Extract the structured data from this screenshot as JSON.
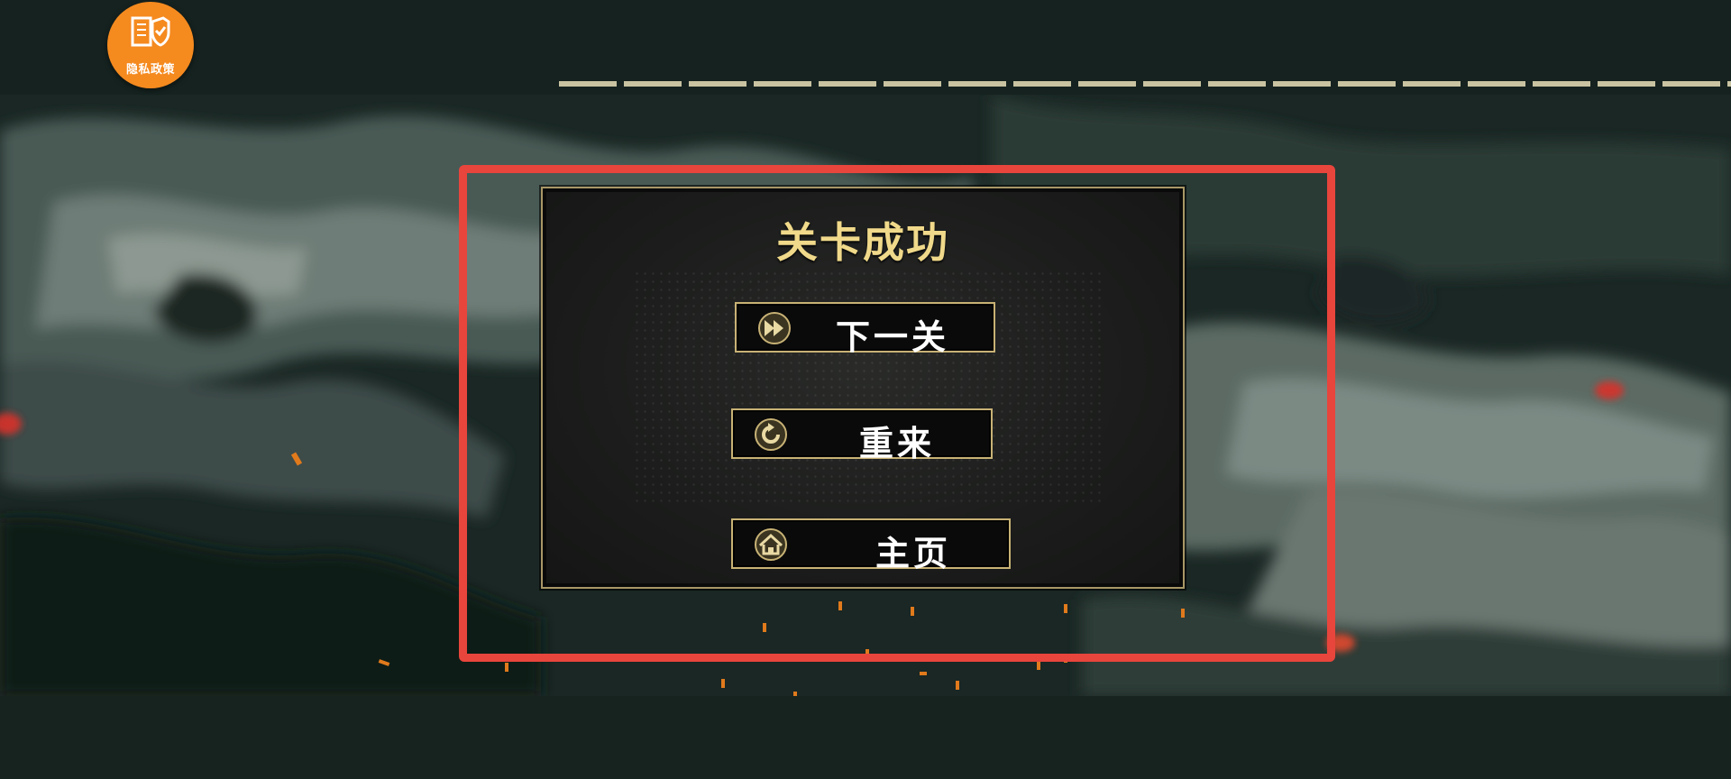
{
  "privacy_badge": {
    "label": "隐私政策",
    "icon": "privacy-shield-icon",
    "color": "#f58a1f"
  },
  "dialog": {
    "title": "关卡成功",
    "title_color": "#f0d98a",
    "border_color": "#c8b275",
    "buttons": [
      {
        "label": "下一关",
        "icon": "fast-forward-icon"
      },
      {
        "label": "重来",
        "icon": "restart-icon"
      },
      {
        "label": "主页",
        "icon": "home-icon"
      }
    ]
  },
  "highlight_color": "#e8453c"
}
